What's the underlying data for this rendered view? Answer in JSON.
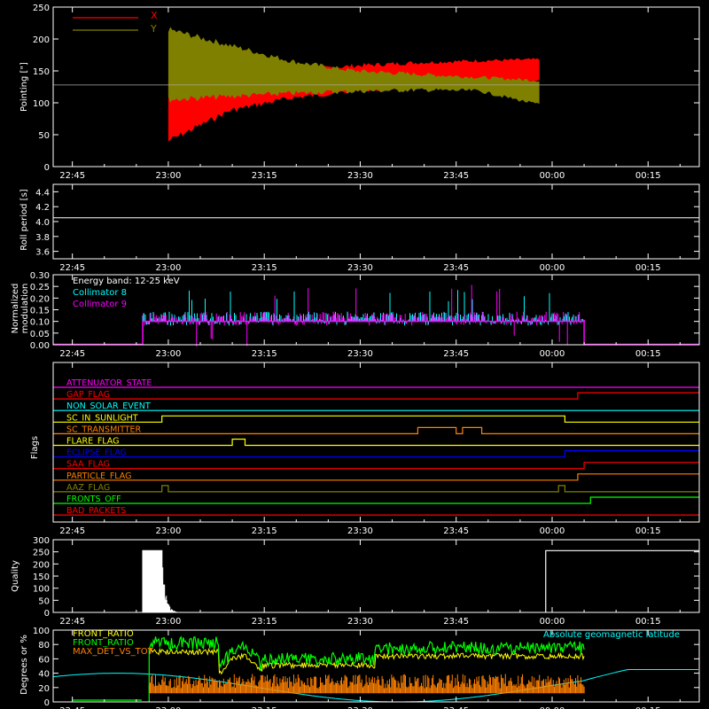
{
  "time_ticks": [
    "22:45",
    "23:00",
    "23:15",
    "23:30",
    "23:45",
    "00:00",
    "00:15"
  ],
  "colors": {
    "background": "#000000",
    "axis": "#ffffff",
    "x_series": "#ff0000",
    "y_series": "#808000",
    "collimator8": "#00ffff",
    "collimator9": "#ff00ff",
    "front_ratio_1": "#ffff00",
    "front_ratio_2": "#00ff00",
    "max_det": "#ff8000",
    "latitude": "#00ffff"
  },
  "chart_data": [
    {
      "type": "area",
      "ylabel": "Pointing [\"]",
      "ylim": [
        0,
        250
      ],
      "yticks": [
        "0",
        "50",
        "100",
        "150",
        "200",
        "250"
      ],
      "x_range": [
        "22:42",
        "00:23"
      ],
      "reference_line": 128,
      "legend": {
        "placement": "top-left",
        "entries": [
          {
            "name": "X",
            "color": "#ff0000"
          },
          {
            "name": "Y",
            "color": "#808000"
          }
        ]
      },
      "series": [
        {
          "name": "X",
          "start": "23:00",
          "end": "23:58",
          "lower": [
            40,
            88,
            108,
            118,
            126,
            132,
            136
          ],
          "upper": [
            135,
            140,
            150,
            158,
            163,
            166,
            168
          ]
        },
        {
          "name": "Y",
          "start": "23:00",
          "end": "23:58",
          "lower": [
            105,
            110,
            115,
            118,
            120,
            119,
            97
          ],
          "upper": [
            215,
            190,
            165,
            150,
            145,
            140,
            135
          ]
        }
      ]
    },
    {
      "type": "line",
      "ylabel": "Roll period [s]",
      "ylim": [
        3.5,
        4.5
      ],
      "yticks": [
        "3.6",
        "3.8",
        "4.0",
        "4.2",
        "4.4"
      ],
      "value": 4.05
    },
    {
      "type": "bar",
      "ylabel": "Normalized modulation",
      "ylim": [
        0,
        0.3
      ],
      "yticks": [
        "0.00",
        "0.05",
        "0.10",
        "0.15",
        "0.20",
        "0.25",
        "0.30"
      ],
      "annotation": "Energy band: 12-25 keV",
      "start": "22:56",
      "end": "00:05",
      "baseline": 0.1,
      "series": [
        {
          "name": "Collimator 8"
        },
        {
          "name": "Collimator 9"
        }
      ]
    },
    {
      "type": "line",
      "ylabel": "Flags",
      "flags": [
        {
          "name": "ATTENUATOR_STATE",
          "color": "#ff00ff",
          "steps": []
        },
        {
          "name": "GAP_FLAG",
          "color": "#ff0000",
          "steps": [
            [
              "00:04",
              1
            ]
          ]
        },
        {
          "name": "NON_SOLAR_EVENT",
          "color": "#00ffff",
          "steps": []
        },
        {
          "name": "SC_IN_SUNLIGHT",
          "color": "#ffff00",
          "steps": [
            [
              "22:59",
              1
            ],
            [
              "00:02",
              0
            ]
          ]
        },
        {
          "name": "SC_TRANSMITTER",
          "color": "#ff8000",
          "steps": [
            [
              "23:39",
              1
            ],
            [
              "23:45",
              0
            ],
            [
              "23:46",
              1
            ],
            [
              "23:49",
              0
            ]
          ]
        },
        {
          "name": "FLARE_FLAG",
          "color": "#ffff00",
          "steps": [
            [
              "23:10",
              1
            ],
            [
              "23:12",
              0
            ]
          ]
        },
        {
          "name": "ECLIPSE_FLAG",
          "color": "#0000ff",
          "steps": [
            [
              "22:59",
              0
            ],
            [
              "00:02",
              1
            ]
          ]
        },
        {
          "name": "SAA_FLAG",
          "color": "#ff0000",
          "steps": [
            [
              "00:05",
              1
            ]
          ]
        },
        {
          "name": "PARTICLE_FLAG",
          "color": "#ff8000",
          "steps": [
            [
              "00:04",
              1
            ]
          ]
        },
        {
          "name": "AAZ_FLAG",
          "color": "#808000",
          "steps": [
            [
              "22:59",
              1
            ],
            [
              "23:00",
              0
            ],
            [
              "00:01",
              1
            ],
            [
              "00:02",
              0
            ]
          ]
        },
        {
          "name": "FRONTS_OFF",
          "color": "#00ff00",
          "steps": [
            [
              "22:56",
              0
            ],
            [
              "00:06",
              1
            ]
          ]
        },
        {
          "name": "BAD_PACKETS",
          "color": "#ff0000",
          "steps": []
        }
      ]
    },
    {
      "type": "bar",
      "ylabel": "Quality",
      "ylim": [
        0,
        300
      ],
      "yticks": [
        "0",
        "50",
        "100",
        "150",
        "200",
        "250",
        "300"
      ],
      "segments": [
        {
          "start": "22:56",
          "end": "22:59",
          "value": 255
        },
        {
          "start": "23:59",
          "end": "00:23",
          "value": 255
        }
      ]
    },
    {
      "type": "line",
      "ylabel": "Degrees or %",
      "ylim": [
        0,
        100
      ],
      "yticks": [
        "0",
        "20",
        "40",
        "60",
        "80",
        "100"
      ],
      "series": [
        {
          "name": "FRONT_RATIO",
          "color": "#ffff00"
        },
        {
          "name": "FRONT_RATIO",
          "color": "#00ff00"
        },
        {
          "name": "MAX_DET_VS_TOT",
          "color": "#ff8000"
        },
        {
          "name": "Absolute geomagnetic latitude",
          "color": "#00ffff"
        }
      ]
    }
  ]
}
